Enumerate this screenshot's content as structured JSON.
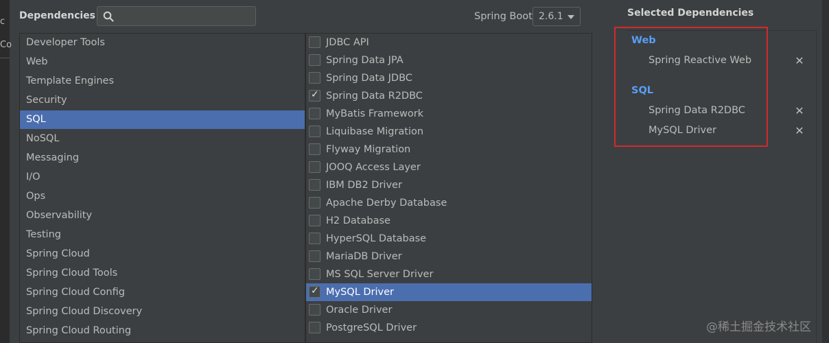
{
  "edge": {
    "t1": "c",
    "t2": "Co"
  },
  "header": {
    "dependencies_label": "Dependencies",
    "search": {
      "value": "",
      "placeholder": ""
    },
    "spring_boot_label": "Spring Boot",
    "spring_boot_version": "2.6.1"
  },
  "categories": [
    {
      "label": "Developer Tools",
      "selected": false
    },
    {
      "label": "Web",
      "selected": false
    },
    {
      "label": "Template Engines",
      "selected": false
    },
    {
      "label": "Security",
      "selected": false
    },
    {
      "label": "SQL",
      "selected": true
    },
    {
      "label": "NoSQL",
      "selected": false
    },
    {
      "label": "Messaging",
      "selected": false
    },
    {
      "label": "I/O",
      "selected": false
    },
    {
      "label": "Ops",
      "selected": false
    },
    {
      "label": "Observability",
      "selected": false
    },
    {
      "label": "Testing",
      "selected": false
    },
    {
      "label": "Spring Cloud",
      "selected": false
    },
    {
      "label": "Spring Cloud Tools",
      "selected": false
    },
    {
      "label": "Spring Cloud Config",
      "selected": false
    },
    {
      "label": "Spring Cloud Discovery",
      "selected": false
    },
    {
      "label": "Spring Cloud Routing",
      "selected": false
    }
  ],
  "dependencies": [
    {
      "label": "JDBC API",
      "checked": false,
      "selected": false
    },
    {
      "label": "Spring Data JPA",
      "checked": false,
      "selected": false
    },
    {
      "label": "Spring Data JDBC",
      "checked": false,
      "selected": false
    },
    {
      "label": "Spring Data R2DBC",
      "checked": true,
      "selected": false
    },
    {
      "label": "MyBatis Framework",
      "checked": false,
      "selected": false
    },
    {
      "label": "Liquibase Migration",
      "checked": false,
      "selected": false
    },
    {
      "label": "Flyway Migration",
      "checked": false,
      "selected": false
    },
    {
      "label": "JOOQ Access Layer",
      "checked": false,
      "selected": false
    },
    {
      "label": "IBM DB2 Driver",
      "checked": false,
      "selected": false
    },
    {
      "label": "Apache Derby Database",
      "checked": false,
      "selected": false
    },
    {
      "label": "H2 Database",
      "checked": false,
      "selected": false
    },
    {
      "label": "HyperSQL Database",
      "checked": false,
      "selected": false
    },
    {
      "label": "MariaDB Driver",
      "checked": false,
      "selected": false
    },
    {
      "label": "MS SQL Server Driver",
      "checked": false,
      "selected": false
    },
    {
      "label": "MySQL Driver",
      "checked": true,
      "selected": true
    },
    {
      "label": "Oracle Driver",
      "checked": false,
      "selected": false
    },
    {
      "label": "PostgreSQL Driver",
      "checked": false,
      "selected": false
    }
  ],
  "selected_panel": {
    "title": "Selected Dependencies",
    "groups": [
      {
        "name": "Web",
        "items": [
          "Spring Reactive Web"
        ]
      },
      {
        "name": "SQL",
        "items": [
          "Spring Data R2DBC",
          "MySQL Driver"
        ]
      }
    ],
    "remove_glyph": "✕"
  },
  "check_glyph": "✓",
  "watermark": "@稀土掘金技术社区",
  "colors": {
    "background": "#3c3f41",
    "selection": "#4b6eaf",
    "group_header": "#589df6",
    "highlight_box": "#d32a2a"
  }
}
